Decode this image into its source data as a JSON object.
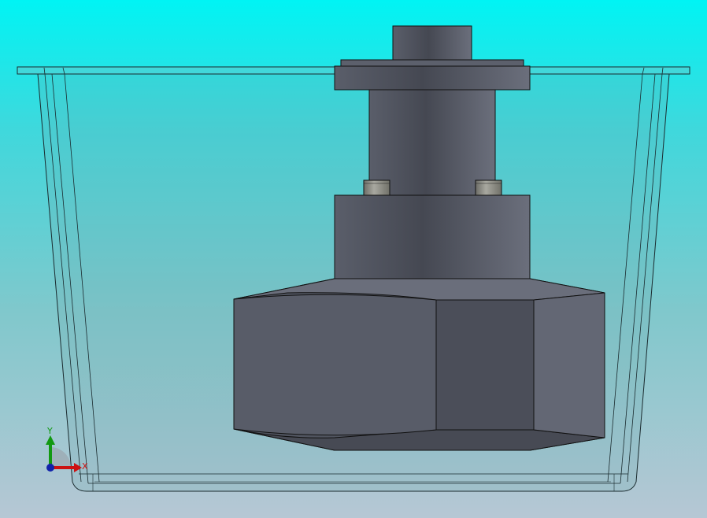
{
  "viewport": {
    "background_top": "#00f4f4",
    "background_bottom": "#b6c7d4"
  },
  "model": {
    "tank_glass_color": "#7fb7bb",
    "part_color": "#4c505c",
    "part_light_color": "#6a6e7a",
    "part_dark_color": "#40434d",
    "pin_color": "#8a8a84",
    "edge_color": "#111111"
  },
  "triad": {
    "x_label": "X",
    "y_label": "Y",
    "x_color": "#cc1111",
    "y_color": "#119911",
    "z_color": "#1122aa"
  }
}
